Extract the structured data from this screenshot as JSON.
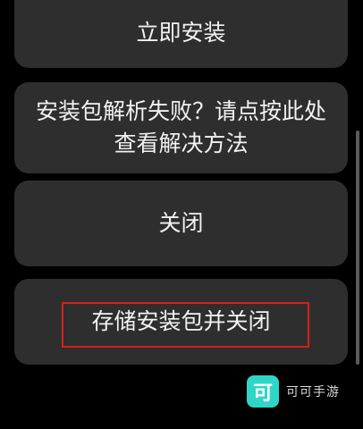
{
  "dialog": {
    "install_label": "立即安装",
    "help_label": "安装包解析失败？请点按此处查看解决方法",
    "close_label": "关闭",
    "save_close_label": "存储安装包并关闭"
  },
  "watermark": {
    "logo_char": "可",
    "text": "可可手游"
  },
  "colors": {
    "background": "#000000",
    "button_bg": "#2e2e2e",
    "button_text": "#f2f2f2",
    "highlight": "#d42020",
    "brand": "#2fd6c8"
  }
}
